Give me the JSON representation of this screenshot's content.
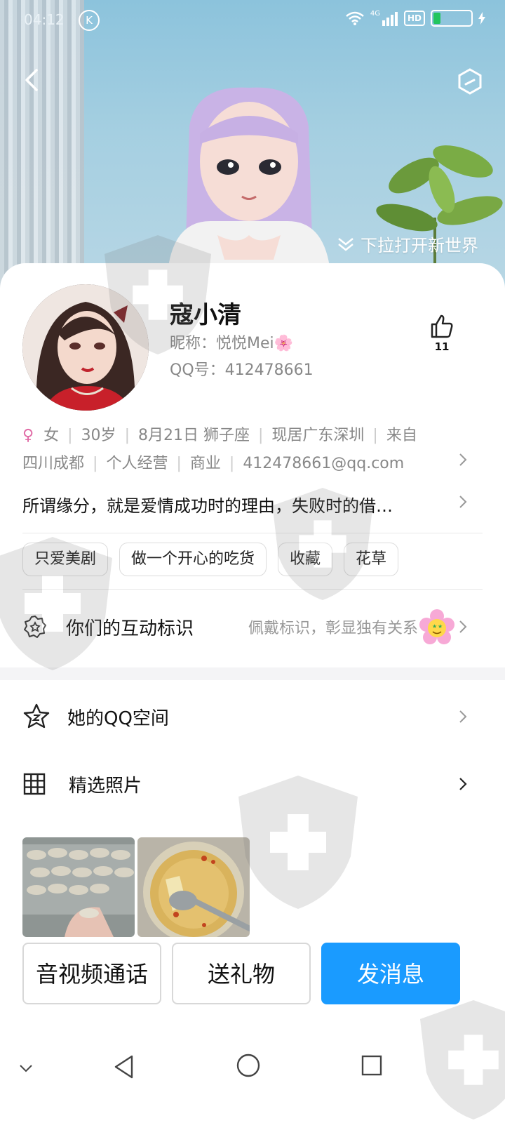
{
  "status_bar": {
    "time": "04:12",
    "k_badge": "K",
    "network": "4G",
    "hd": "HD"
  },
  "header": {
    "pull_hint": "下拉打开新世界"
  },
  "profile": {
    "name": "寇小清",
    "nickname": "昵称：悦悦Mei🌸",
    "qq_number": "QQ号：412478661",
    "likes": "11"
  },
  "info": {
    "gender_icon": "♀",
    "items": [
      "女",
      "30岁",
      "8月21日  狮子座",
      "现居广东深圳",
      "来自四川成都",
      "个人经营",
      "商业",
      "412478661@qq.com"
    ],
    "line1": {
      "gender": "女",
      "age": "30岁",
      "birthday": "8月21日  狮子座",
      "location": "现居广东深圳",
      "from_prefix": "来自"
    },
    "line2": {
      "from_city": "四川成都",
      "job": "个人经营",
      "industry": "商业",
      "email": "412478661@qq.com"
    },
    "motto": "所谓缘分，就是爱情成功时的理由，失败时的借…"
  },
  "tags": [
    "只爱美剧",
    "做一个开心的吃货",
    "收藏",
    "花草"
  ],
  "interaction": {
    "label": "你们的互动标识",
    "subtitle": "佩戴标识，彰显独有关系"
  },
  "sections": {
    "qzone": "她的QQ空间",
    "photos": "精选照片"
  },
  "actions": {
    "call": "音视频通话",
    "gift": "送礼物",
    "message": "发消息"
  },
  "colors": {
    "primary": "#1a9bff",
    "gender": "#e06aa5",
    "battery": "#22c55e"
  }
}
